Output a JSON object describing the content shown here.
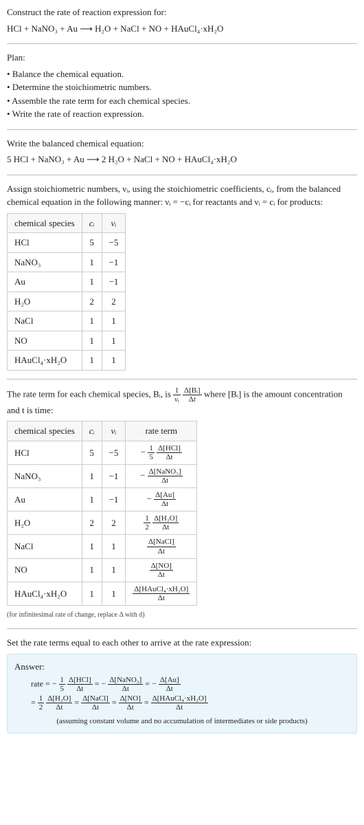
{
  "intro": {
    "prompt": "Construct the rate of reaction expression for:",
    "equation": "HCl + NaNO₃ + Au ⟶ H₂O + NaCl + NO + HAuCl₄·xH₂O"
  },
  "plan": {
    "heading": "Plan:",
    "items": [
      "• Balance the chemical equation.",
      "• Determine the stoichiometric numbers.",
      "• Assemble the rate term for each chemical species.",
      "• Write the rate of reaction expression."
    ]
  },
  "balanced": {
    "heading": "Write the balanced chemical equation:",
    "equation": "5 HCl + NaNO₃ + Au ⟶ 2 H₂O + NaCl + NO + HAuCl₄·xH₂O"
  },
  "stoich": {
    "intro1": "Assign stoichiometric numbers, νᵢ, using the stoichiometric coefficients, cᵢ, from the balanced chemical equation in the following manner: νᵢ = −cᵢ for reactants and νᵢ = cᵢ for products:",
    "headers": [
      "chemical species",
      "cᵢ",
      "νᵢ"
    ],
    "rows": [
      {
        "species": "HCl",
        "c": "5",
        "v": "−5"
      },
      {
        "species": "NaNO₃",
        "c": "1",
        "v": "−1"
      },
      {
        "species": "Au",
        "c": "1",
        "v": "−1"
      },
      {
        "species": "H₂O",
        "c": "2",
        "v": "2"
      },
      {
        "species": "NaCl",
        "c": "1",
        "v": "1"
      },
      {
        "species": "NO",
        "c": "1",
        "v": "1"
      },
      {
        "species": "HAuCl₄·xH₂O",
        "c": "1",
        "v": "1"
      }
    ]
  },
  "rateterm": {
    "intro_pre": "The rate term for each chemical species, Bᵢ, is ",
    "intro_post": " where [Bᵢ] is the amount concentration and t is time:",
    "headers": [
      "chemical species",
      "cᵢ",
      "νᵢ",
      "rate term"
    ],
    "rows": [
      {
        "species": "HCl",
        "c": "5",
        "v": "−5",
        "sign": "−",
        "coef_num": "1",
        "coef_den": "5",
        "dnum": "Δ[HCl]",
        "dden": "Δt"
      },
      {
        "species": "NaNO₃",
        "c": "1",
        "v": "−1",
        "sign": "−",
        "coef_num": "",
        "coef_den": "",
        "dnum": "Δ[NaNO₃]",
        "dden": "Δt"
      },
      {
        "species": "Au",
        "c": "1",
        "v": "−1",
        "sign": "−",
        "coef_num": "",
        "coef_den": "",
        "dnum": "Δ[Au]",
        "dden": "Δt"
      },
      {
        "species": "H₂O",
        "c": "2",
        "v": "2",
        "sign": "",
        "coef_num": "1",
        "coef_den": "2",
        "dnum": "Δ[H₂O]",
        "dden": "Δt"
      },
      {
        "species": "NaCl",
        "c": "1",
        "v": "1",
        "sign": "",
        "coef_num": "",
        "coef_den": "",
        "dnum": "Δ[NaCl]",
        "dden": "Δt"
      },
      {
        "species": "NO",
        "c": "1",
        "v": "1",
        "sign": "",
        "coef_num": "",
        "coef_den": "",
        "dnum": "Δ[NO]",
        "dden": "Δt"
      },
      {
        "species": "HAuCl₄·xH₂O",
        "c": "1",
        "v": "1",
        "sign": "",
        "coef_num": "",
        "coef_den": "",
        "dnum": "Δ[HAuCl₄·xH₂O]",
        "dden": "Δt"
      }
    ],
    "note": "(for infinitesimal rate of change, replace Δ with d)"
  },
  "final": {
    "heading": "Set the rate terms equal to each other to arrive at the rate expression:",
    "answer_label": "Answer:",
    "line1_prefix": "rate = ",
    "assumption": "(assuming constant volume and no accumulation of intermediates or side products)"
  },
  "chart_data": {
    "type": "table",
    "title": "Stoichiometric numbers and rate terms",
    "tables": [
      {
        "name": "stoichiometric_numbers",
        "columns": [
          "chemical species",
          "c_i",
          "nu_i"
        ],
        "rows": [
          [
            "HCl",
            5,
            -5
          ],
          [
            "NaNO3",
            1,
            -1
          ],
          [
            "Au",
            1,
            -1
          ],
          [
            "H2O",
            2,
            2
          ],
          [
            "NaCl",
            1,
            1
          ],
          [
            "NO",
            1,
            1
          ],
          [
            "HAuCl4·xH2O",
            1,
            1
          ]
        ]
      },
      {
        "name": "rate_terms",
        "columns": [
          "chemical species",
          "c_i",
          "nu_i",
          "rate_term"
        ],
        "rows": [
          [
            "HCl",
            5,
            -5,
            "-(1/5) Δ[HCl]/Δt"
          ],
          [
            "NaNO3",
            1,
            -1,
            "- Δ[NaNO3]/Δt"
          ],
          [
            "Au",
            1,
            -1,
            "- Δ[Au]/Δt"
          ],
          [
            "H2O",
            2,
            2,
            "(1/2) Δ[H2O]/Δt"
          ],
          [
            "NaCl",
            1,
            1,
            "Δ[NaCl]/Δt"
          ],
          [
            "NO",
            1,
            1,
            "Δ[NO]/Δt"
          ],
          [
            "HAuCl4·xH2O",
            1,
            1,
            "Δ[HAuCl4·xH2O]/Δt"
          ]
        ]
      }
    ],
    "rate_expression": "rate = -(1/5) Δ[HCl]/Δt = - Δ[NaNO3]/Δt = - Δ[Au]/Δt = (1/2) Δ[H2O]/Δt = Δ[NaCl]/Δt = Δ[NO]/Δt = Δ[HAuCl4·xH2O]/Δt"
  }
}
